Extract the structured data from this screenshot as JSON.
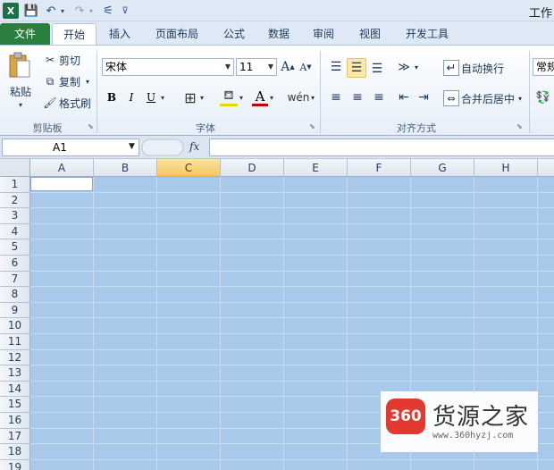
{
  "title": {
    "text": "工作"
  },
  "app_icon": "X",
  "quick_access": {
    "save_icon": "💾",
    "undo_icon": "↶",
    "redo_icon": "↷",
    "tool_icon": "⚟",
    "customize_icon": "⊽"
  },
  "tabs": [
    {
      "label": "文件"
    },
    {
      "label": "开始"
    },
    {
      "label": "插入"
    },
    {
      "label": "页面布局"
    },
    {
      "label": "公式"
    },
    {
      "label": "数据"
    },
    {
      "label": "审阅"
    },
    {
      "label": "视图"
    },
    {
      "label": "开发工具"
    }
  ],
  "clipboard": {
    "paste": "粘贴",
    "cut": "剪切",
    "copy": "复制",
    "format_painter": "格式刷",
    "label": "剪贴板"
  },
  "font": {
    "name": "宋体",
    "size": "11",
    "label": "字体",
    "bold": "B",
    "italic": "I",
    "underline": "U",
    "grow": "A",
    "shrink": "A"
  },
  "alignment": {
    "wrap_text": "自动换行",
    "merge_center": "合并后居中",
    "label": "对齐方式"
  },
  "number": {
    "format": "常规"
  },
  "name_box": {
    "value": "A1"
  },
  "fx_label": "fx",
  "columns": [
    "A",
    "B",
    "C",
    "D",
    "E",
    "F",
    "G",
    "H"
  ],
  "rows": [
    "1",
    "2",
    "3",
    "4",
    "5",
    "6",
    "7",
    "8",
    "9",
    "10",
    "11",
    "12",
    "13",
    "14",
    "15",
    "16",
    "17",
    "18",
    "19"
  ],
  "watermark": {
    "logo": "360",
    "name": "货源之家",
    "url": "www.360hyzj.com"
  }
}
